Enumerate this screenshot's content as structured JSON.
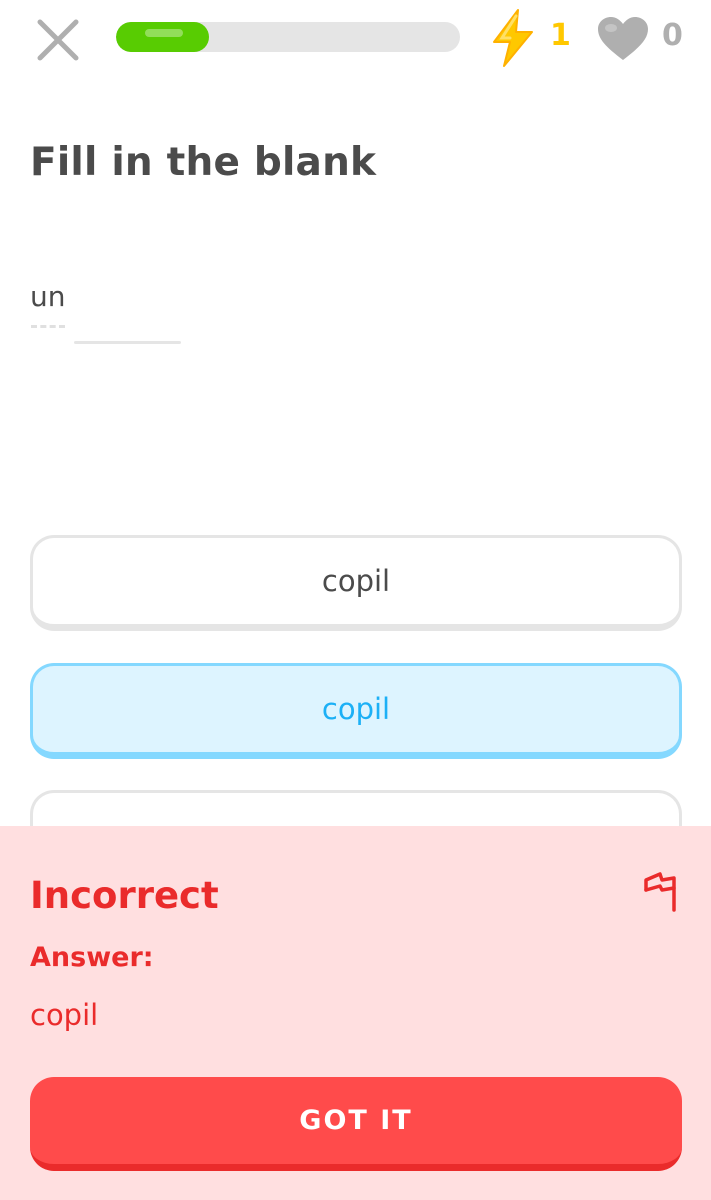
{
  "header": {
    "close_icon": "close-icon",
    "progress": 0.27,
    "streak_count": "1",
    "streak_icon": "lightning-icon",
    "hearts_count": "0",
    "hearts_icon": "heart-icon"
  },
  "exercise": {
    "title": "Fill in the blank",
    "sentence_word": "un"
  },
  "options": [
    {
      "label": "copil",
      "state": "default"
    },
    {
      "label": "copil",
      "state": "selected"
    },
    {
      "label": "",
      "state": "default"
    }
  ],
  "feedback": {
    "status": "Incorrect",
    "answer_label": "Answer:",
    "answer_value": "copil",
    "button_label": "GOT IT",
    "report_icon": "flag-icon"
  },
  "colors": {
    "progress_fill": "#58cc02",
    "streak": "#ffc800",
    "heart": "#afafaf",
    "selected_bg": "#ddf4ff",
    "selected_border": "#84d8ff",
    "selected_text": "#1cb0f6",
    "feedback_bg": "#ffdfe0",
    "error": "#ea2b2b",
    "button": "#ff4b4b"
  }
}
